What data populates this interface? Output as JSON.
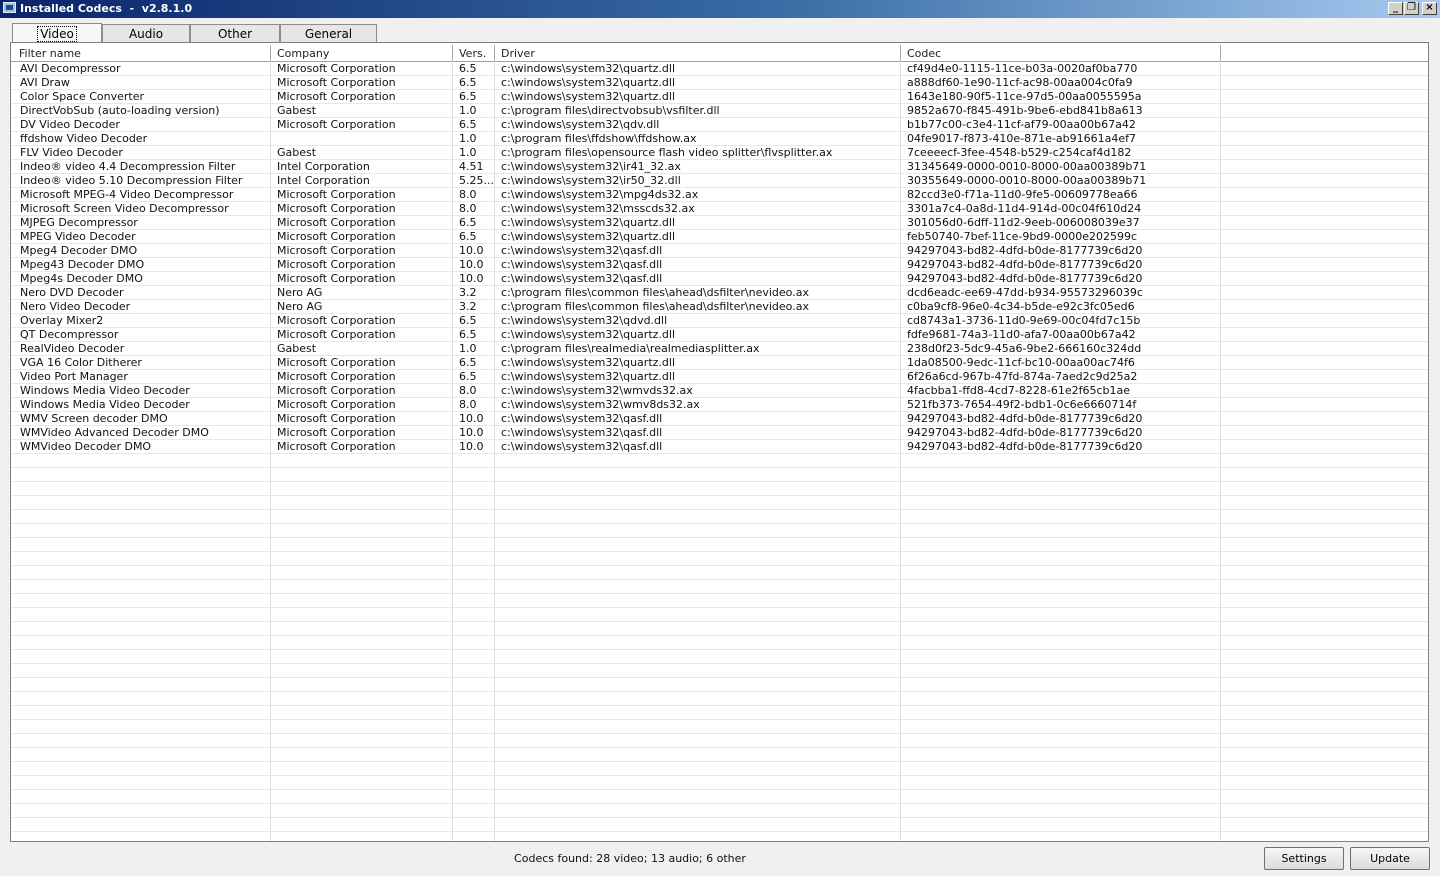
{
  "window": {
    "title": "Installed Codecs  -  v2.8.1.0"
  },
  "tabs": [
    "Video",
    "Audio",
    "Other",
    "General"
  ],
  "columns": [
    "Filter name",
    "Company",
    "Vers.",
    "Driver",
    "Codec"
  ],
  "rows": [
    [
      "AVI Decompressor",
      "Microsoft Corporation",
      "6.5",
      "c:\\windows\\system32\\quartz.dll",
      "cf49d4e0-1115-11ce-b03a-0020af0ba770"
    ],
    [
      "AVI Draw",
      "Microsoft Corporation",
      "6.5",
      "c:\\windows\\system32\\quartz.dll",
      "a888df60-1e90-11cf-ac98-00aa004c0fa9"
    ],
    [
      "Color Space Converter",
      "Microsoft Corporation",
      "6.5",
      "c:\\windows\\system32\\quartz.dll",
      "1643e180-90f5-11ce-97d5-00aa0055595a"
    ],
    [
      "DirectVobSub (auto-loading version)",
      "Gabest",
      "1.0",
      "c:\\program files\\directvobsub\\vsfilter.dll",
      "9852a670-f845-491b-9be6-ebd841b8a613"
    ],
    [
      "DV Video Decoder",
      "Microsoft Corporation",
      "6.5",
      "c:\\windows\\system32\\qdv.dll",
      "b1b77c00-c3e4-11cf-af79-00aa00b67a42"
    ],
    [
      "ffdshow Video Decoder",
      "",
      "1.0",
      "c:\\program files\\ffdshow\\ffdshow.ax",
      "04fe9017-f873-410e-871e-ab91661a4ef7"
    ],
    [
      "FLV Video Decoder",
      "Gabest",
      "1.0",
      "c:\\program files\\opensource flash video splitter\\flvsplitter.ax",
      "7ceeeecf-3fee-4548-b529-c254caf4d182"
    ],
    [
      "Indeo® video 4.4 Decompression Filter",
      "Intel Corporation",
      "4.51",
      "c:\\windows\\system32\\ir41_32.ax",
      "31345649-0000-0010-8000-00aa00389b71"
    ],
    [
      "Indeo® video 5.10 Decompression Filter",
      "Intel Corporation",
      "5.25...",
      "c:\\windows\\system32\\ir50_32.dll",
      "30355649-0000-0010-8000-00aa00389b71"
    ],
    [
      "Microsoft MPEG-4 Video Decompressor",
      "Microsoft Corporation",
      "8.0",
      "c:\\windows\\system32\\mpg4ds32.ax",
      "82ccd3e0-f71a-11d0-9fe5-00609778ea66"
    ],
    [
      "Microsoft Screen Video Decompressor",
      "Microsoft Corporation",
      "8.0",
      "c:\\windows\\system32\\msscds32.ax",
      "3301a7c4-0a8d-11d4-914d-00c04f610d24"
    ],
    [
      "MJPEG Decompressor",
      "Microsoft Corporation",
      "6.5",
      "c:\\windows\\system32\\quartz.dll",
      "301056d0-6dff-11d2-9eeb-006008039e37"
    ],
    [
      "MPEG Video Decoder",
      "Microsoft Corporation",
      "6.5",
      "c:\\windows\\system32\\quartz.dll",
      "feb50740-7bef-11ce-9bd9-0000e202599c"
    ],
    [
      "Mpeg4 Decoder DMO",
      "Microsoft Corporation",
      "10.0",
      "c:\\windows\\system32\\qasf.dll",
      "94297043-bd82-4dfd-b0de-8177739c6d20"
    ],
    [
      "Mpeg43 Decoder DMO",
      "Microsoft Corporation",
      "10.0",
      "c:\\windows\\system32\\qasf.dll",
      "94297043-bd82-4dfd-b0de-8177739c6d20"
    ],
    [
      "Mpeg4s Decoder DMO",
      "Microsoft Corporation",
      "10.0",
      "c:\\windows\\system32\\qasf.dll",
      "94297043-bd82-4dfd-b0de-8177739c6d20"
    ],
    [
      "Nero DVD Decoder",
      "Nero AG",
      "3.2",
      "c:\\program files\\common files\\ahead\\dsfilter\\nevideo.ax",
      "dcd6eadc-ee69-47dd-b934-95573296039c"
    ],
    [
      "Nero Video Decoder",
      "Nero AG",
      "3.2",
      "c:\\program files\\common files\\ahead\\dsfilter\\nevideo.ax",
      "c0ba9cf8-96e0-4c34-b5de-e92c3fc05ed6"
    ],
    [
      "Overlay Mixer2",
      "Microsoft Corporation",
      "6.5",
      "c:\\windows\\system32\\qdvd.dll",
      "cd8743a1-3736-11d0-9e69-00c04fd7c15b"
    ],
    [
      "QT Decompressor",
      "Microsoft Corporation",
      "6.5",
      "c:\\windows\\system32\\quartz.dll",
      "fdfe9681-74a3-11d0-afa7-00aa00b67a42"
    ],
    [
      "RealVideo Decoder",
      "Gabest",
      "1.0",
      "c:\\program files\\realmedia\\realmediasplitter.ax",
      "238d0f23-5dc9-45a6-9be2-666160c324dd"
    ],
    [
      "VGA 16 Color Ditherer",
      "Microsoft Corporation",
      "6.5",
      "c:\\windows\\system32\\quartz.dll",
      "1da08500-9edc-11cf-bc10-00aa00ac74f6"
    ],
    [
      "Video Port Manager",
      "Microsoft Corporation",
      "6.5",
      "c:\\windows\\system32\\quartz.dll",
      "6f26a6cd-967b-47fd-874a-7aed2c9d25a2"
    ],
    [
      "Windows Media Video Decoder",
      "Microsoft Corporation",
      "8.0",
      "c:\\windows\\system32\\wmvds32.ax",
      "4facbba1-ffd8-4cd7-8228-61e2f65cb1ae"
    ],
    [
      "Windows Media Video Decoder",
      "Microsoft Corporation",
      "8.0",
      "c:\\windows\\system32\\wmv8ds32.ax",
      "521fb373-7654-49f2-bdb1-0c6e6660714f"
    ],
    [
      "WMV Screen decoder DMO",
      "Microsoft Corporation",
      "10.0",
      "c:\\windows\\system32\\qasf.dll",
      "94297043-bd82-4dfd-b0de-8177739c6d20"
    ],
    [
      "WMVideo Advanced Decoder DMO",
      "Microsoft Corporation",
      "10.0",
      "c:\\windows\\system32\\qasf.dll",
      "94297043-bd82-4dfd-b0de-8177739c6d20"
    ],
    [
      "WMVideo Decoder DMO",
      "Microsoft Corporation",
      "10.0",
      "c:\\windows\\system32\\qasf.dll",
      "94297043-bd82-4dfd-b0de-8177739c6d20"
    ]
  ],
  "status": "Codecs found: 28 video; 13 audio; 6 other",
  "buttons": {
    "settings": "Settings",
    "update": "Update"
  },
  "icons": {
    "minimize": "minimize-icon",
    "maximize": "restore-icon",
    "close": "close-icon"
  },
  "colors": {
    "titlebar_start": "#0a246a",
    "titlebar_end": "#a6caf0",
    "list_bg": "#ffffff"
  }
}
